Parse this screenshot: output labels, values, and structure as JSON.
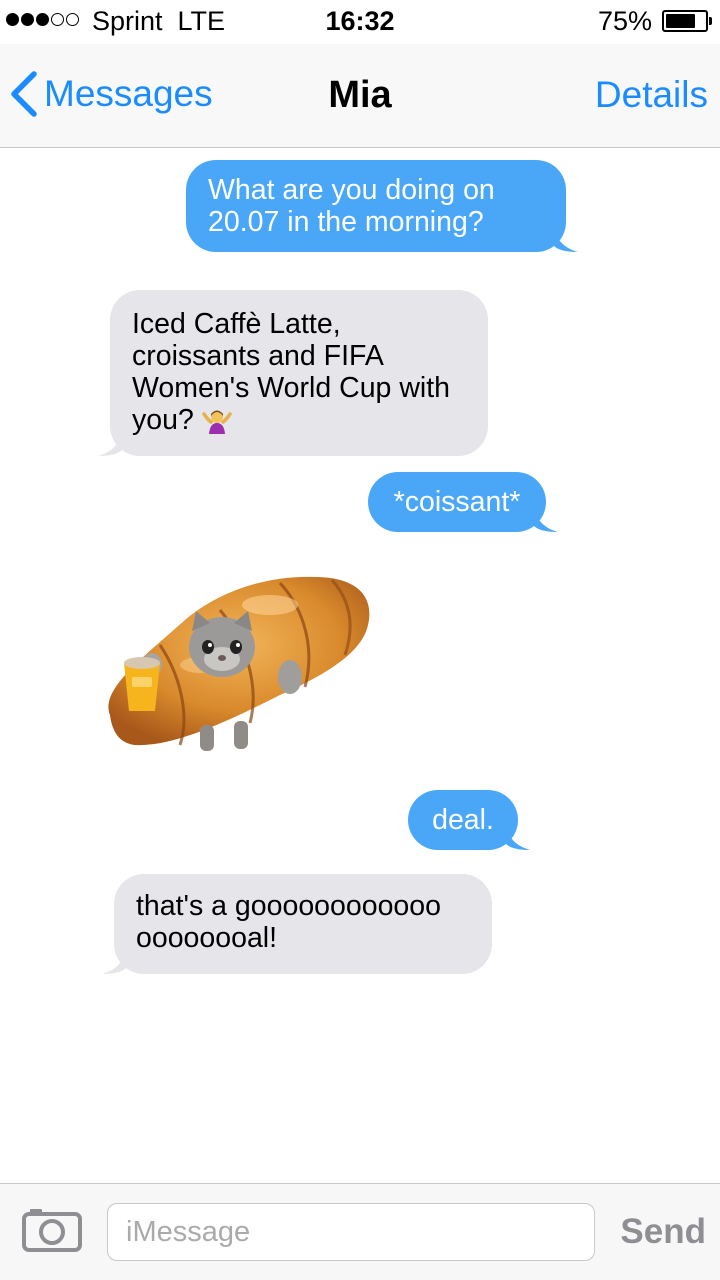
{
  "status_bar": {
    "carrier": "Sprint  LTE",
    "time": "16:32",
    "battery_percent": "75%",
    "signal_bars_filled": 3,
    "signal_bars_total": 5
  },
  "nav": {
    "back_label": "Messages",
    "title": "Mia",
    "details_label": "Details",
    "accent_color": "#1a8cff"
  },
  "messages": [
    {
      "direction": "sent",
      "text": "What are you doing on 20.07 in the morning?"
    },
    {
      "direction": "received",
      "text": "Iced Caffè Latte, croissants and FIFA Women's World Cup with you?",
      "emoji": "woman-shrugging-emoji"
    },
    {
      "direction": "sent",
      "text": "*coissant*"
    },
    {
      "direction": "received",
      "type": "sticker",
      "sticker": "cat-in-croissant-holding-coffee-cup"
    },
    {
      "direction": "sent",
      "text": "deal."
    },
    {
      "direction": "received",
      "text": "that's a goooooooooooo oooooooal!"
    }
  ],
  "colors": {
    "sent_bubble": "#4aa7f8",
    "received_bubble": "#e5e5ea"
  },
  "input_bar": {
    "placeholder": "iMessage",
    "send_label": "Send",
    "camera_icon": "camera-icon"
  }
}
